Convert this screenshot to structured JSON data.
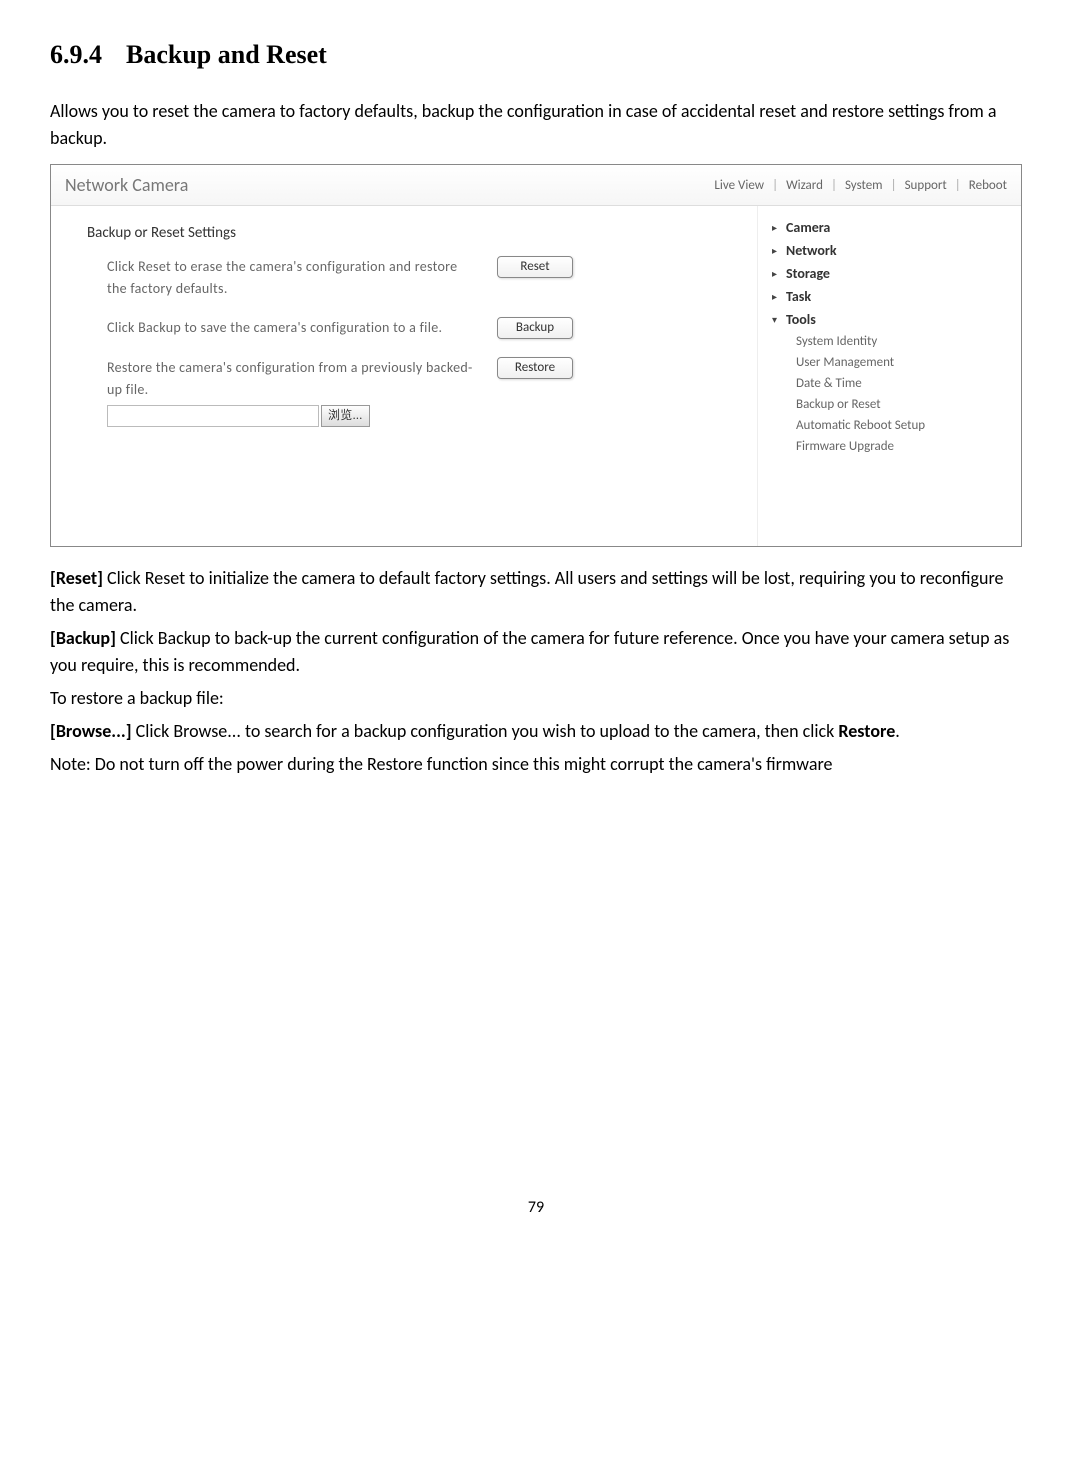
{
  "heading_number": "6.9.4",
  "heading_title": "Backup and Reset",
  "intro": "Allows you to reset the camera to factory defaults, backup the configuration in case of accidental reset and restore settings from a backup.",
  "screenshot": {
    "title": "Network Camera",
    "nav": [
      "Live View",
      "Wizard",
      "System",
      "Support",
      "Reboot"
    ],
    "section_title": "Backup or Reset Settings",
    "rows": [
      {
        "text": "Click Reset to erase the camera's configuration and restore the factory defaults.",
        "button": "Reset"
      },
      {
        "text": "Click Backup to save the camera's configuration to a file.",
        "button": "Backup"
      },
      {
        "text": "Restore the camera's configuration from a previously backed-up file.",
        "button": "Restore",
        "browse": "浏览..."
      }
    ],
    "sidebar": {
      "items": [
        {
          "caret": "▸",
          "label": "Camera"
        },
        {
          "caret": "▸",
          "label": "Network"
        },
        {
          "caret": "▸",
          "label": "Storage"
        },
        {
          "caret": "▸",
          "label": "Task"
        },
        {
          "caret": "▾",
          "label": "Tools"
        }
      ],
      "subs": [
        "System Identity",
        "User Management",
        "Date & Time",
        "Backup or Reset",
        "Automatic Reboot Setup",
        "Firmware Upgrade"
      ]
    }
  },
  "desc": {
    "reset_label": "[Reset]",
    "reset_text": " Click Reset to initialize the camera to default factory settings. All users and settings will be lost, requiring you to reconfigure the camera.",
    "backup_label": "[Backup]",
    "backup_text": " Click Backup to back-up the current configuration of the camera for future reference. Once you have your camera setup as you require, this is recommended.",
    "restore_intro": "To restore a backup file:",
    "browse_label": "[Browse...]",
    "browse_text": " Click Browse... to search for a backup configuration you wish to upload to the camera, then click ",
    "restore_bold": "Restore",
    "restore_after": ".",
    "note": "Note: Do not turn off the power during the Restore function since this might corrupt the camera's firmware"
  },
  "pagenum": "79"
}
